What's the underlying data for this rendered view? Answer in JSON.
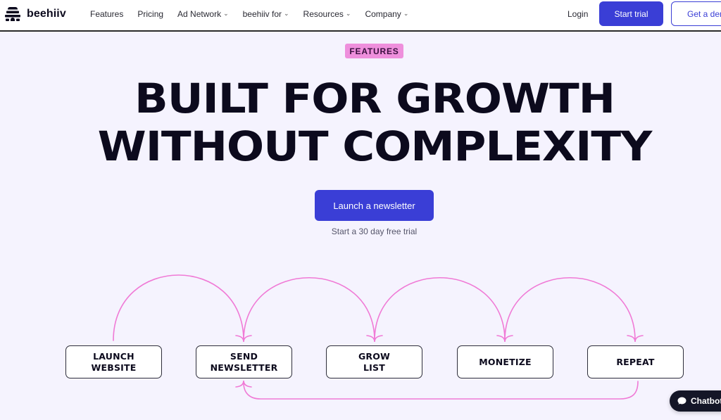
{
  "nav": {
    "logo_text": "beehiiv",
    "logo_icon": "beehive-icon",
    "links": [
      {
        "label": "Features",
        "has_dropdown": false
      },
      {
        "label": "Pricing",
        "has_dropdown": false
      },
      {
        "label": "Ad Network",
        "has_dropdown": true
      },
      {
        "label": "beehiiv for",
        "has_dropdown": true
      },
      {
        "label": "Resources",
        "has_dropdown": true
      },
      {
        "label": "Company",
        "has_dropdown": true
      }
    ],
    "dropdown_glyph": "⌄",
    "login_label": "Login",
    "start_trial_label": "Start trial",
    "demo_label": "Get a demo"
  },
  "hero": {
    "badge": "FEATURES",
    "headline_line1": "BUILT FOR GROWTH",
    "headline_line2": "WITHOUT COMPLEXITY",
    "cta_label": "Launch a newsletter",
    "cta_note": "Start a 30 day free trial"
  },
  "flow": {
    "steps": [
      {
        "label": "LAUNCH\nWEBSITE"
      },
      {
        "label": "SEND\nNEWSLETTER"
      },
      {
        "label": "GROW\nLIST"
      },
      {
        "label": "MONETIZE"
      },
      {
        "label": "REPEAT"
      }
    ],
    "arrow_color": "#f07ad6"
  },
  "chatbot": {
    "label": "Chatbot"
  },
  "colors": {
    "brand_blue": "#3a3ed6",
    "badge_pink": "#ee8fdc",
    "background": "#f5f3fe",
    "ink": "#0c0a1d"
  }
}
